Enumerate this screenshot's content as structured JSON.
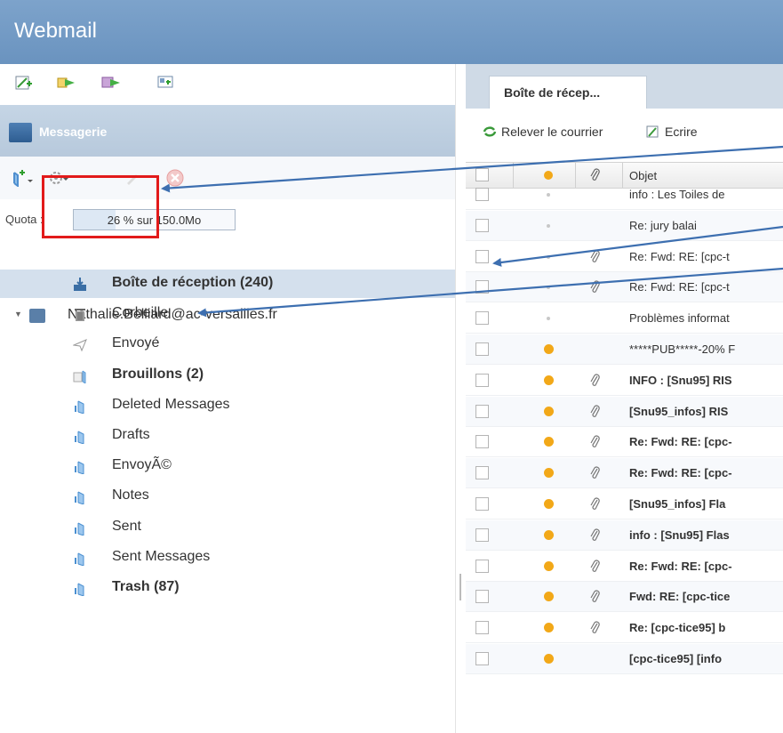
{
  "app": {
    "title": "Webmail"
  },
  "left": {
    "section_title": "Messagerie",
    "quota": {
      "label": "Quota :",
      "text": "26 % sur 150.0Mo",
      "fraction": 0.26
    },
    "account": "Nathalie.Belliard@ac-versailles.fr",
    "folders": [
      {
        "name": "Boîte de réception (240)",
        "bold": true,
        "selected": true,
        "icon": "inbox-icon"
      },
      {
        "name": "Corbeille",
        "bold": false,
        "icon": "trash-can-icon"
      },
      {
        "name": "Envoyé",
        "bold": false,
        "icon": "paper-plane-icon"
      },
      {
        "name": "Brouillons (2)",
        "bold": true,
        "icon": "drafts-folder-icon"
      },
      {
        "name": "Deleted Messages",
        "bold": false,
        "icon": "folder-icon"
      },
      {
        "name": "Drafts",
        "bold": false,
        "icon": "folder-icon"
      },
      {
        "name": "EnvoyÃ©",
        "bold": false,
        "icon": "folder-icon"
      },
      {
        "name": "Notes",
        "bold": false,
        "icon": "folder-icon"
      },
      {
        "name": "Sent",
        "bold": false,
        "icon": "folder-icon"
      },
      {
        "name": "Sent Messages",
        "bold": false,
        "icon": "folder-icon"
      },
      {
        "name": "Trash (87)",
        "bold": true,
        "icon": "folder-icon"
      }
    ]
  },
  "right": {
    "tab": "Boîte de récep...",
    "toolbar": {
      "fetch": "Relever le courrier",
      "compose": "Ecrire"
    },
    "columns": {
      "subject": "Objet"
    },
    "messages": [
      {
        "subject": "info : Les Toiles de",
        "read": true,
        "attach": false,
        "bold": false
      },
      {
        "subject": "Re: jury balai",
        "read": true,
        "attach": false,
        "bold": false
      },
      {
        "subject": "Re: Fwd: RE: [cpc-t",
        "read": true,
        "attach": true,
        "bold": false
      },
      {
        "subject": "Re: Fwd: RE: [cpc-t",
        "read": true,
        "attach": true,
        "bold": false
      },
      {
        "subject": "Problèmes informat",
        "read": true,
        "attach": false,
        "bold": false
      },
      {
        "subject": "*****PUB*****-20% F",
        "read": false,
        "attach": false,
        "bold": false
      },
      {
        "subject": "INFO : [Snu95] RIS",
        "read": false,
        "attach": true,
        "bold": true
      },
      {
        "subject": "[Snu95_infos] RIS",
        "read": false,
        "attach": true,
        "bold": true
      },
      {
        "subject": "Re: Fwd: RE: [cpc-",
        "read": false,
        "attach": true,
        "bold": true
      },
      {
        "subject": "Re: Fwd: RE: [cpc-",
        "read": false,
        "attach": true,
        "bold": true
      },
      {
        "subject": "[Snu95_infos] Fla",
        "read": false,
        "attach": true,
        "bold": true
      },
      {
        "subject": "info : [Snu95] Flas",
        "read": false,
        "attach": true,
        "bold": true
      },
      {
        "subject": "Re: Fwd: RE: [cpc-",
        "read": false,
        "attach": true,
        "bold": true
      },
      {
        "subject": "Fwd: RE: [cpc-tice",
        "read": false,
        "attach": true,
        "bold": true
      },
      {
        "subject": "Re: [cpc-tice95] b",
        "read": false,
        "attach": true,
        "bold": true
      },
      {
        "subject": "[cpc-tice95] [info",
        "read": false,
        "attach": false,
        "bold": true
      }
    ]
  },
  "colors": {
    "header": "#6e96c1",
    "selected": "#d4e0ed",
    "unread_dot": "#f2a818",
    "read_dot": "#c8c8c8",
    "annotation_arrow": "#3d6fb0",
    "annotation_box": "#e21a1a"
  }
}
